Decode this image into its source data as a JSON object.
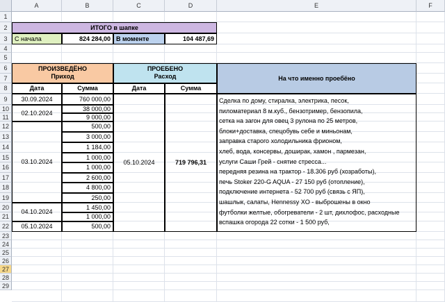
{
  "columns": [
    "A",
    "B",
    "C",
    "D",
    "E",
    "F"
  ],
  "rows": [
    "1",
    "2",
    "3",
    "4",
    "5",
    "6",
    "7",
    "8",
    "9",
    "10",
    "11",
    "12",
    "13",
    "14",
    "15",
    "16",
    "17",
    "18",
    "19",
    "20",
    "21",
    "22",
    "23",
    "24",
    "25",
    "26",
    "27",
    "28",
    "29"
  ],
  "summary": {
    "title": "ИТОГО в шапке",
    "since_start_label": "С начала",
    "since_start_value": "824 284,00",
    "at_moment_label": "В моменте",
    "at_moment_value": "104 487,69"
  },
  "income": {
    "header1": "ПРОИЗВЕДЁНО",
    "header2": "Приход",
    "date_col": "Дата",
    "sum_col": "Сумма",
    "dates": [
      "30.09.2024",
      "02.10.2024",
      "03.10.2024",
      "04.10.2024",
      "05.10.2024"
    ],
    "amounts": [
      "760 000,00",
      "38 000,00",
      "9 000,00",
      "500,00",
      "3 000,00",
      "1 184,00",
      "1 000,00",
      "1 000,00",
      "2 600,00",
      "4 800,00",
      "250,00",
      "1 450,00",
      "1 000,00",
      "500,00"
    ]
  },
  "expense": {
    "header1": "ПРОЕБЕНО",
    "header2": "Расход",
    "date_col": "Дата",
    "sum_col": "Сумма",
    "date": "05.10.2024",
    "amount": "719 796,31"
  },
  "details": {
    "header": "На что именно проебёно",
    "lines": [
      "Сделка по дому, стиралка, электрика, песок,",
      "пиломатериал 8 м.куб., бензотример, бензопила,",
      "сетка на загон для овец 3 рулона по 25 метров,",
      "блоки+доставка, спецобувь себе и миньонам,",
      "заправка старого холодильника фрионом,",
      "хлеб, вода, консервы, доширак, хамон , пармезан,",
      "услуги Саши Грей - снятие стресса...",
      "передняя резина на трактор - 18.306 руб (хозработы),",
      "печь Stoker 220-G AQUA - 27 150 руб (отопление),",
      "подключение интернета - 52 700 руб (связь с ЯП),",
      "шашлык, салаты, Hennessy XO - выброшены в окно",
      "футболки желтые, обогреватели - 2 шт, дихлофос, расходные",
      "вспашка огорода 22 сотки - 1 500 руб,"
    ]
  },
  "colors": {
    "summary_header": "#cdb7e2",
    "income_header": "#f9c9a3",
    "expense_header": "#bfe3ef",
    "details_header": "#b8cbe4",
    "since_start_fill": "#dff0c0",
    "at_moment_fill": "#bcd2ee",
    "selected_row": "#f7d88a"
  }
}
